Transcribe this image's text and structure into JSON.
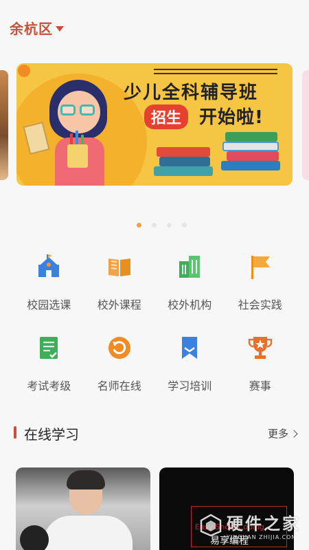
{
  "header": {
    "district": "余杭区",
    "dropdown_icon": "caret-down-icon"
  },
  "banner": {
    "title_line1": "少儿全科辅导班",
    "recruit_badge": "招生",
    "title_line2": "开始啦!",
    "active_index": 0,
    "slide_count": 4,
    "colors": {
      "background": "#f7c544",
      "badge": "#e6402f"
    }
  },
  "categories": [
    {
      "label": "校园选课",
      "icon": "school-icon"
    },
    {
      "label": "校外课程",
      "icon": "open-book-icon"
    },
    {
      "label": "校外机构",
      "icon": "building-icon"
    },
    {
      "label": "社会实践",
      "icon": "flag-icon"
    },
    {
      "label": "考试考级",
      "icon": "exam-sheet-icon"
    },
    {
      "label": "名师在线",
      "icon": "online-refresh-icon"
    },
    {
      "label": "学习培训",
      "icon": "bookmark-icon"
    },
    {
      "label": "赛事",
      "icon": "trophy-icon"
    }
  ],
  "section": {
    "title": "在线学习",
    "more_label": "更多"
  },
  "courses": [
    {
      "kind": "photo"
    },
    {
      "title_en": "Easy Short Coding",
      "title_cn": "易享编程"
    }
  ],
  "watermark": {
    "cn": "硬件之家",
    "en": "YINGJIAN ZHIJIA.COM"
  },
  "colors": {
    "accent": "#c8503b",
    "section_bar": "#d24a3a",
    "active_dot": "#f0a24a"
  }
}
